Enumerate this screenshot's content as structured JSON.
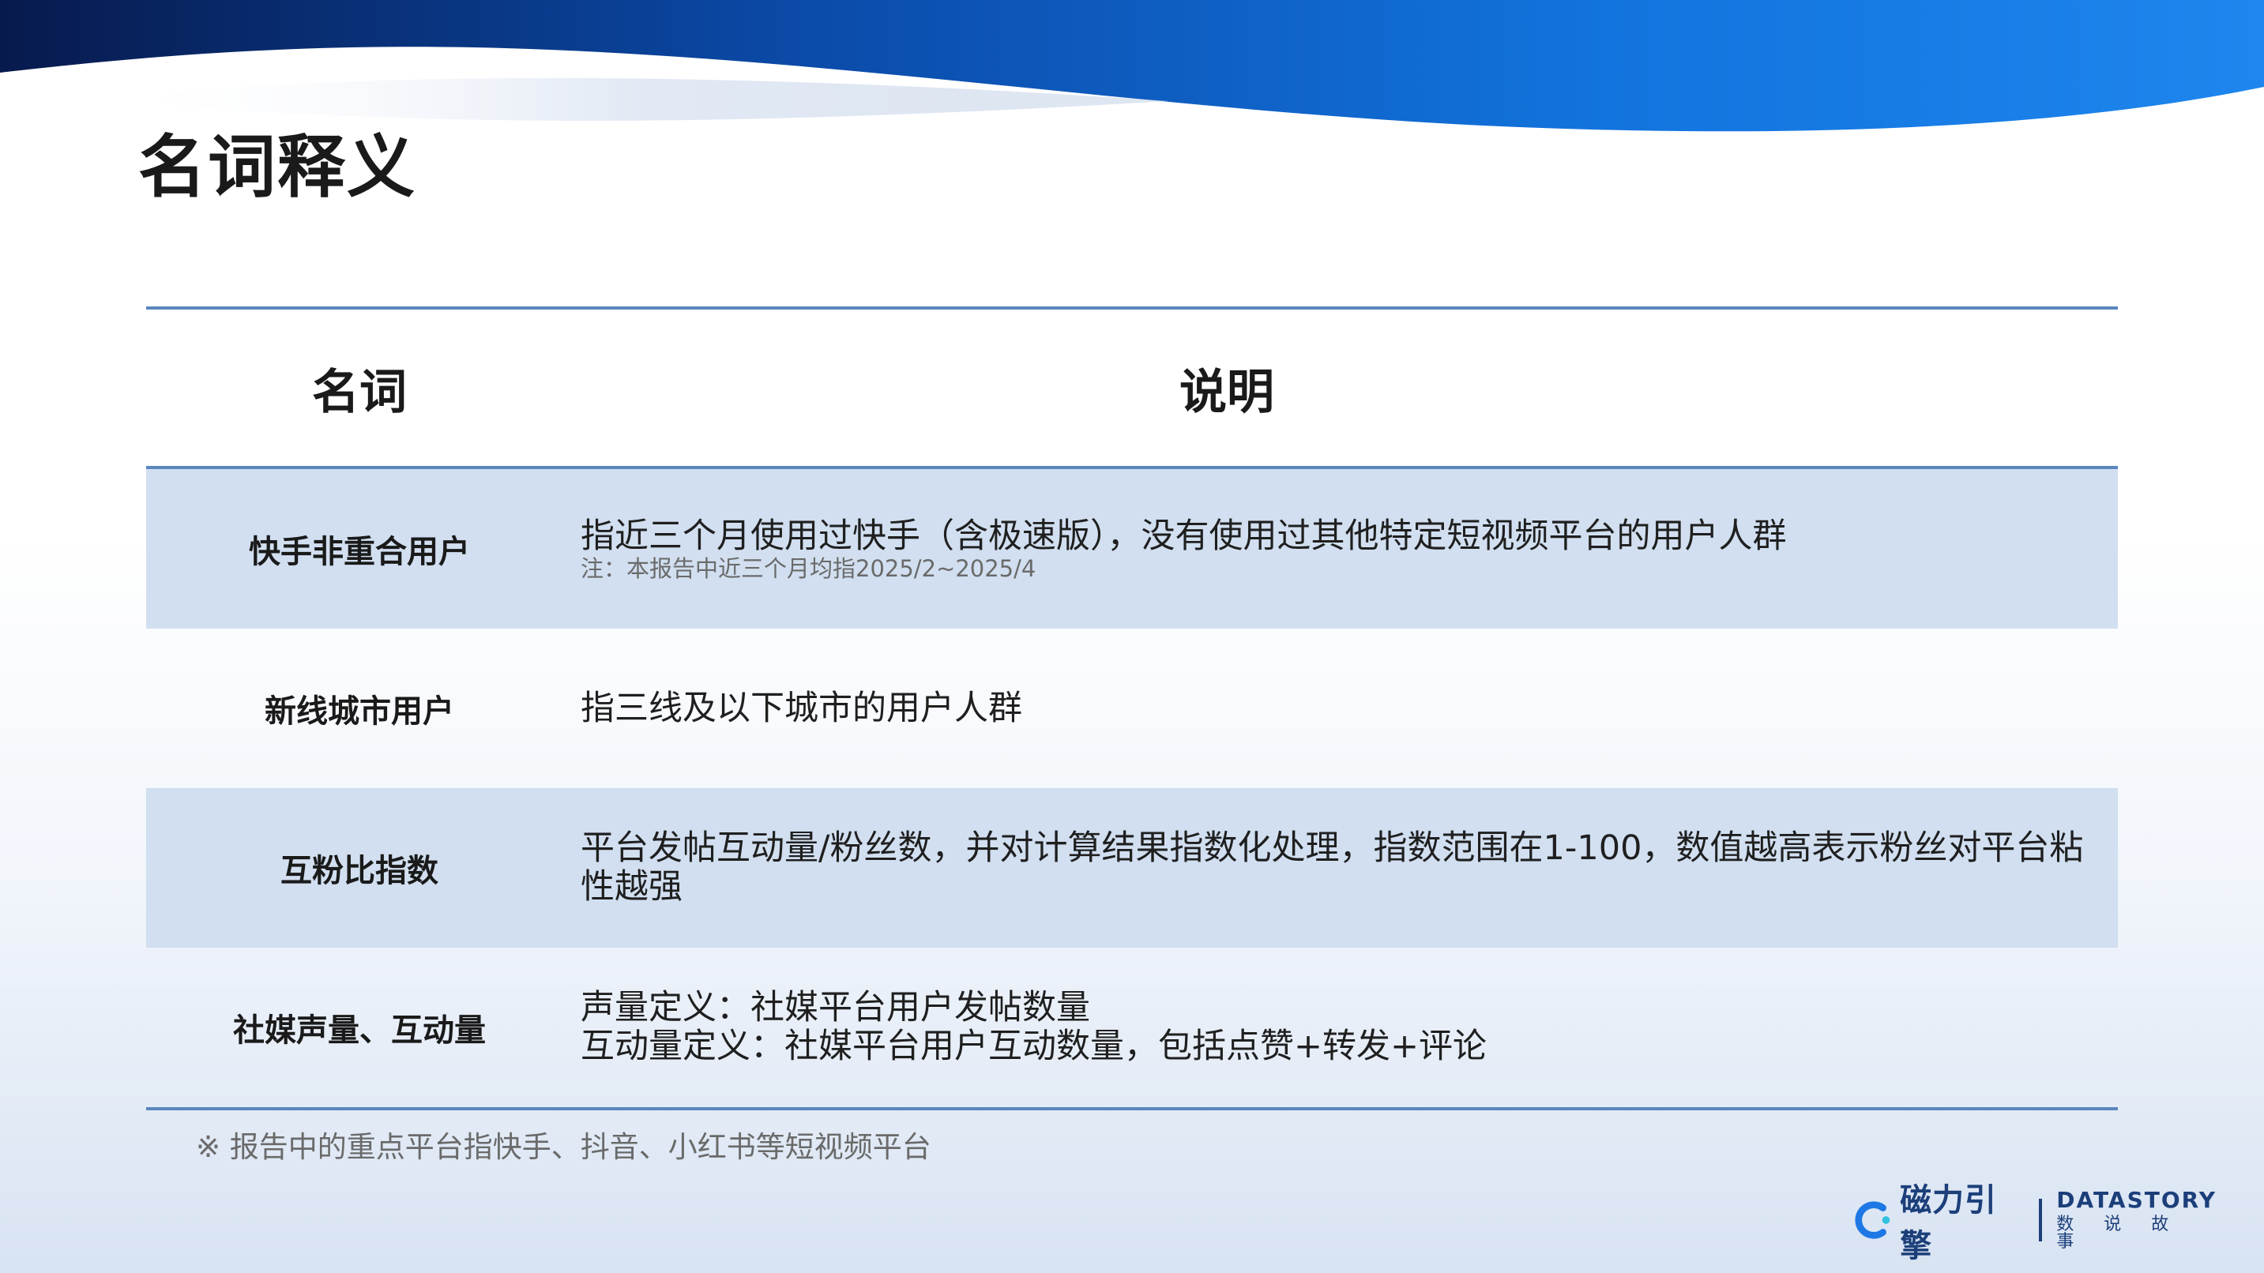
{
  "page": {
    "title": "名词释义"
  },
  "table": {
    "headers": {
      "term": "名词",
      "description": "说明"
    },
    "rows": [
      {
        "term": "快手非重合用户",
        "description": "指近三个月使用过快手（含极速版），没有使用过其他特定短视频平台的用户人群",
        "note": "注：本报告中近三个月均指2025/2~2025/4"
      },
      {
        "term": "新线城市用户",
        "description": "指三线及以下城市的用户人群"
      },
      {
        "term": "互粉比指数",
        "description": "平台发帖互动量/粉丝数，并对计算结果指数化处理，指数范围在1-100，数值越高表示粉丝对平台粘性越强"
      },
      {
        "term": "社媒声量、互动量",
        "description_lines": [
          "声量定义：社媒平台用户发帖数量",
          "互动量定义：社媒平台用户互动数量，包括点赞+转发+评论"
        ]
      }
    ]
  },
  "footnote": "※ 报告中的重点平台指快手、抖音、小红书等短视频平台",
  "logos": {
    "brand_cn": "磁力引擎",
    "partner_en": "DATASTORY",
    "partner_cn": "数说故事"
  },
  "colors": {
    "header_dark": "#0a2a6e",
    "header_blue": "#1d78e6",
    "rule": "#5b86bd",
    "row_shade": "#d1dff0"
  }
}
